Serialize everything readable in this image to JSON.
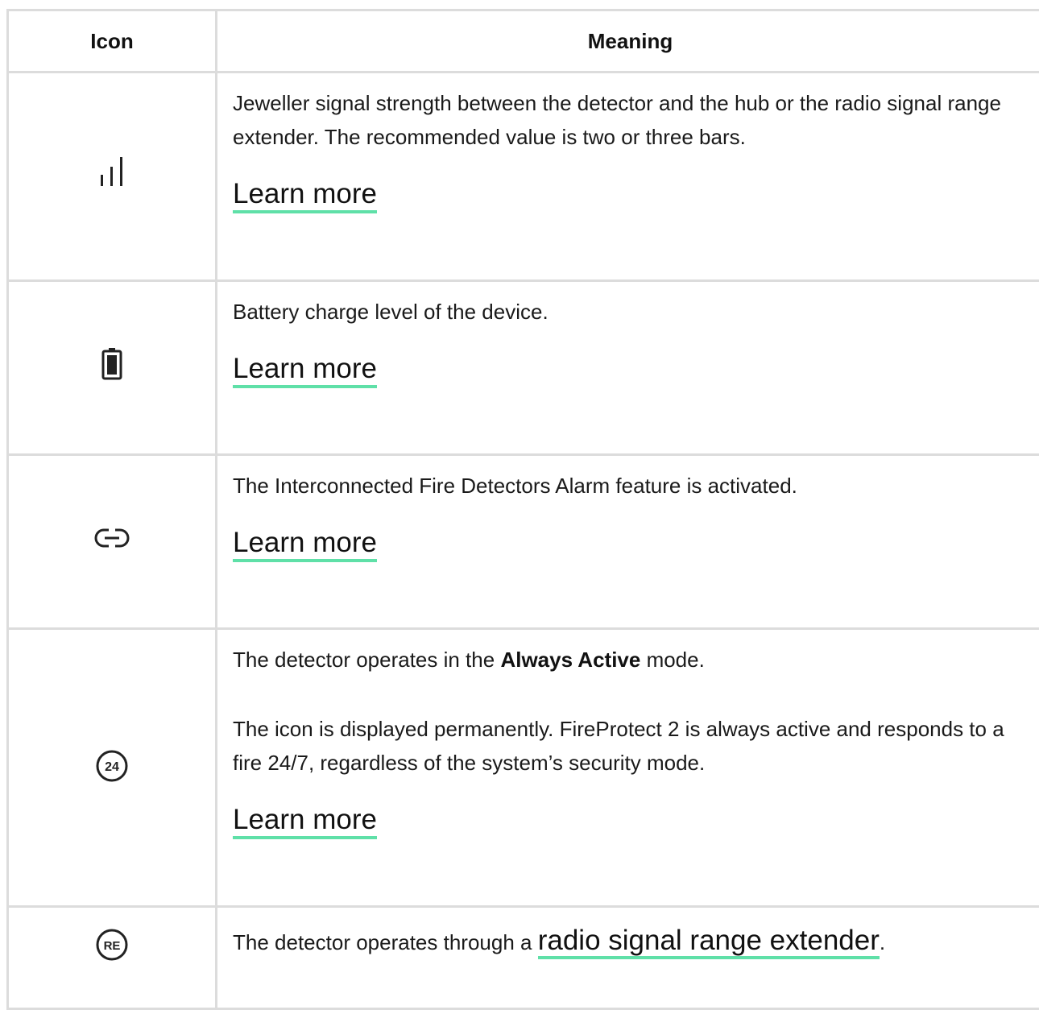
{
  "headers": {
    "icon": "Icon",
    "meaning": "Meaning"
  },
  "rows": [
    {
      "icon": "signal-bars-icon",
      "text": "Jeweller signal strength between the detector and the hub or the radio signal range extender. The recommended value is two or three bars.",
      "link": "Learn more"
    },
    {
      "icon": "battery-icon",
      "text": "Battery charge level of the device.",
      "link": "Learn more"
    },
    {
      "icon": "link-icon",
      "text": "The Interconnected Fire Detectors Alarm feature is activated.",
      "link": "Learn more"
    },
    {
      "icon": "always-active-24-icon",
      "icon_text": "24",
      "text_before": "The detector operates in the ",
      "text_bold": "Always Active",
      "text_after": " mode.",
      "text2": "The icon is displayed permanently. FireProtect 2 is always active and responds to a fire 24/7, regardless of the system’s security mode.",
      "link": "Learn more"
    },
    {
      "icon": "range-extender-icon",
      "icon_text": "RE",
      "text_before": "The detector operates through a ",
      "link": "radio signal range extender",
      "text_after": "."
    }
  ],
  "colors": {
    "link_underline": "#5fe0a8",
    "border": "#dcdcdc",
    "text": "#1a1a1a"
  }
}
